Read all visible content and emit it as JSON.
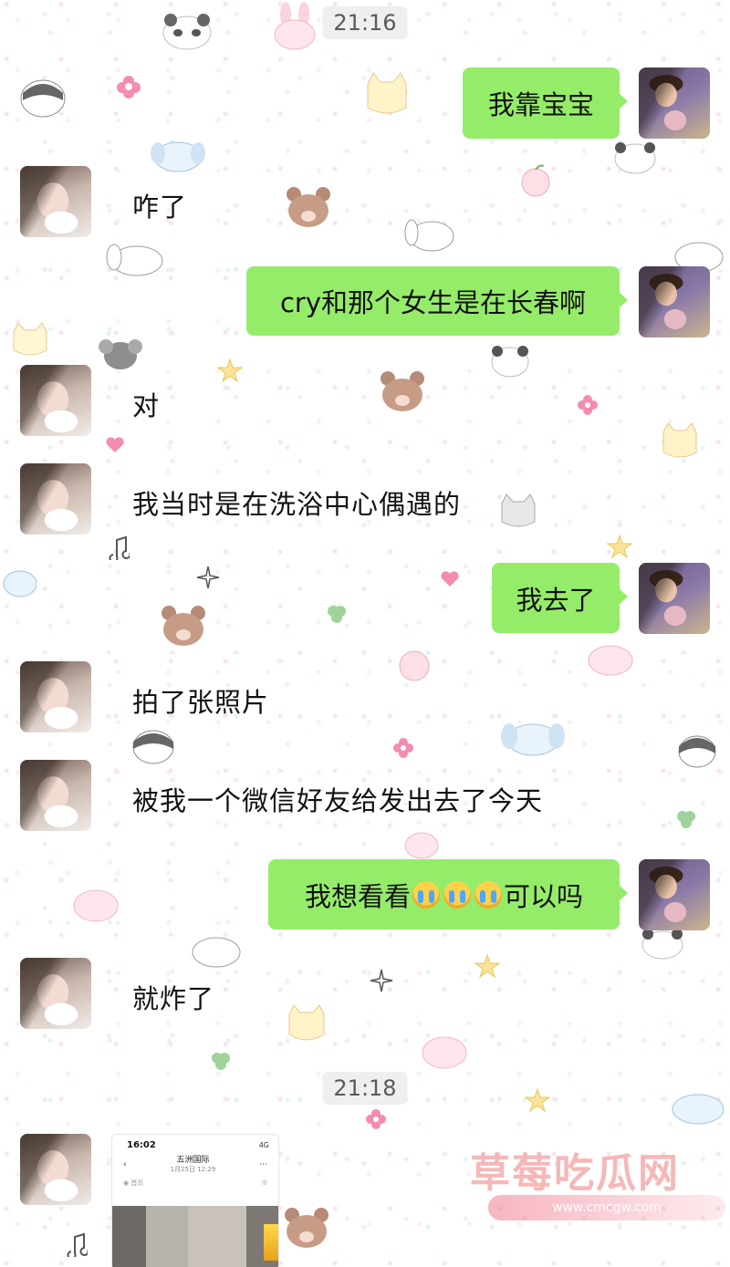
{
  "timestamps": [
    "21:16",
    "21:18"
  ],
  "messages": [
    {
      "side": "right",
      "text": "我靠宝宝"
    },
    {
      "side": "left",
      "text": "咋了"
    },
    {
      "side": "right",
      "text": "cry和那个女生是在长春啊"
    },
    {
      "side": "left",
      "text": "对"
    },
    {
      "side": "left",
      "text": "我当时是在洗浴中心偶遇的"
    },
    {
      "side": "right",
      "text": "我去了"
    },
    {
      "side": "left",
      "text": "拍了张照片"
    },
    {
      "side": "left",
      "text": "被我一个微信好友给发出去了今天"
    },
    {
      "side": "right",
      "text_before": "我想看看",
      "emoji": "loudly-crying-face",
      "emoji_count": 3,
      "text_after": "可以吗"
    },
    {
      "side": "left",
      "text": "就炸了"
    }
  ],
  "image_message": {
    "status_time": "16:02",
    "status_network": "4G",
    "header_title": "五洲国际",
    "header_subtitle": "1月25日 12:29",
    "header_back": "‹",
    "header_more": "···",
    "bar_left": "◉ 首页",
    "bar_right": "◎"
  },
  "watermark": {
    "title": "草莓吃瓜网",
    "url": "www.cmcgw.com"
  },
  "colors": {
    "bubble_self": "#95ec69",
    "text": "#111111",
    "time_pill_bg": "#eeeeee",
    "watermark": "#f1a0a0"
  }
}
